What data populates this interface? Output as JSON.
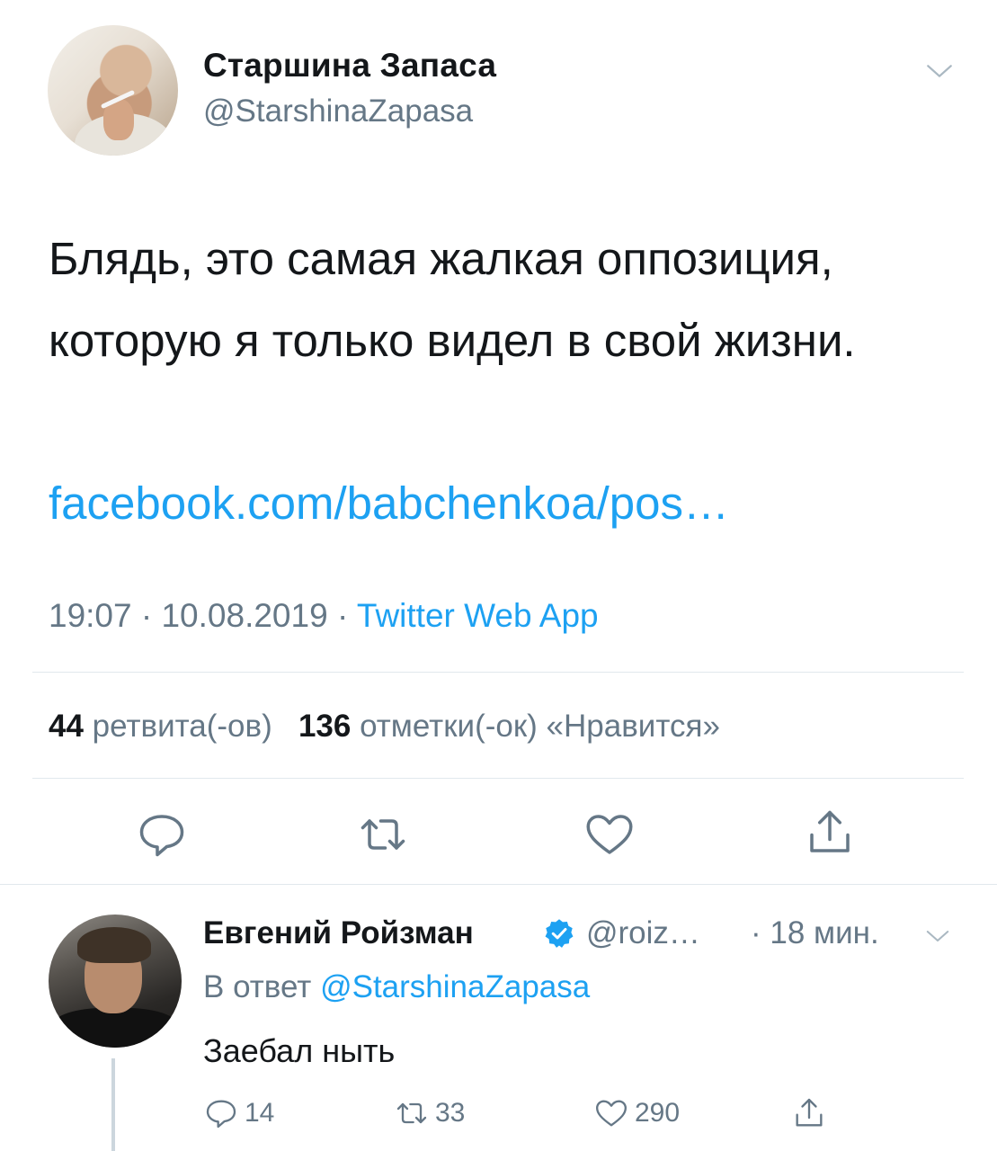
{
  "tweet": {
    "author_name": "Старшина Запаса",
    "author_handle": "@StarshinaZapasa",
    "text": "Блядь, это самая жалкая оппозиция, которую я только видел в свой жизни.",
    "link": "facebook.com/babchenkoa/pos…",
    "time": "19:07",
    "date": "10.08.2019",
    "separator": " · ",
    "source": "Twitter Web App",
    "retweets_count": "44",
    "retweets_label": "ретвита(-ов)",
    "likes_count": "136",
    "likes_label": "отметки(-ок) «Нравится»"
  },
  "reply": {
    "author_name": "Евгений Ройзман",
    "author_handle": "@roiz…",
    "time": "· 18 мин.",
    "reply_prefix": "В ответ",
    "reply_handle": "@StarshinaZapasa",
    "text": "Заебал ныть",
    "reply_count": "14",
    "retweet_count": "33",
    "like_count": "290"
  },
  "colors": {
    "accent": "#1da1f2",
    "secondary_text": "#657786",
    "primary_text": "#14171a",
    "divider": "#e1e8ed"
  },
  "icons": [
    "chevron-down-icon",
    "reply-icon",
    "retweet-icon",
    "like-icon",
    "share-icon",
    "verified-badge-icon"
  ]
}
